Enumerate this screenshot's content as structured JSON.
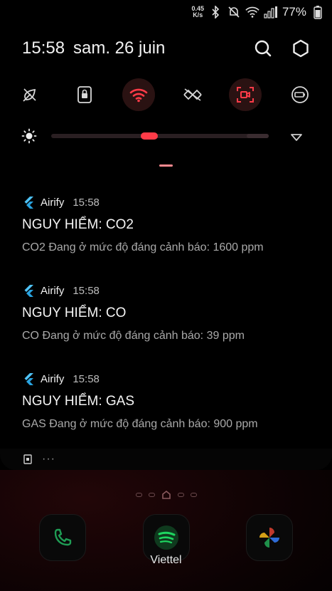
{
  "status_bar": {
    "net_speed_value": "0.45",
    "net_speed_unit": "K/s",
    "battery_percent": "77%"
  },
  "header": {
    "time": "15:58",
    "date": "sam. 26 juin"
  },
  "colors": {
    "accent": "#ff3b48",
    "background": "#000000",
    "secondary_text": "#a9a9a9"
  },
  "quick_settings": [
    {
      "icon": "power-saving-icon",
      "active": false
    },
    {
      "icon": "screen-lock-icon",
      "active": false
    },
    {
      "icon": "wifi-icon",
      "active": true
    },
    {
      "icon": "data-saver-icon",
      "active": false
    },
    {
      "icon": "screen-recorder-icon",
      "active": true
    },
    {
      "icon": "battery-mode-icon",
      "active": false
    }
  ],
  "brightness": {
    "level": 0.45
  },
  "notifications": [
    {
      "app": "Airify",
      "time": "15:58",
      "title": "NGUY HIỂM: CO2",
      "body": "CO2 Đang ở mức độ đáng cảnh báo: 1600 ppm"
    },
    {
      "app": "Airify",
      "time": "15:58",
      "title": "NGUY HIỂM: CO",
      "body": "CO Đang ở mức độ đáng cảnh báo: 39 ppm"
    },
    {
      "app": "Airify",
      "time": "15:58",
      "title": "NGUY HIỂM: GAS",
      "body": "GAS Đang ở mức độ đáng cảnh báo: 900 ppm"
    }
  ],
  "notif_footer": {
    "more": "···"
  },
  "home": {
    "dock": [
      {
        "icon": "phone-icon"
      },
      {
        "icon": "spotify-icon"
      },
      {
        "icon": "photos-icon"
      }
    ],
    "carrier": "Viettel"
  }
}
